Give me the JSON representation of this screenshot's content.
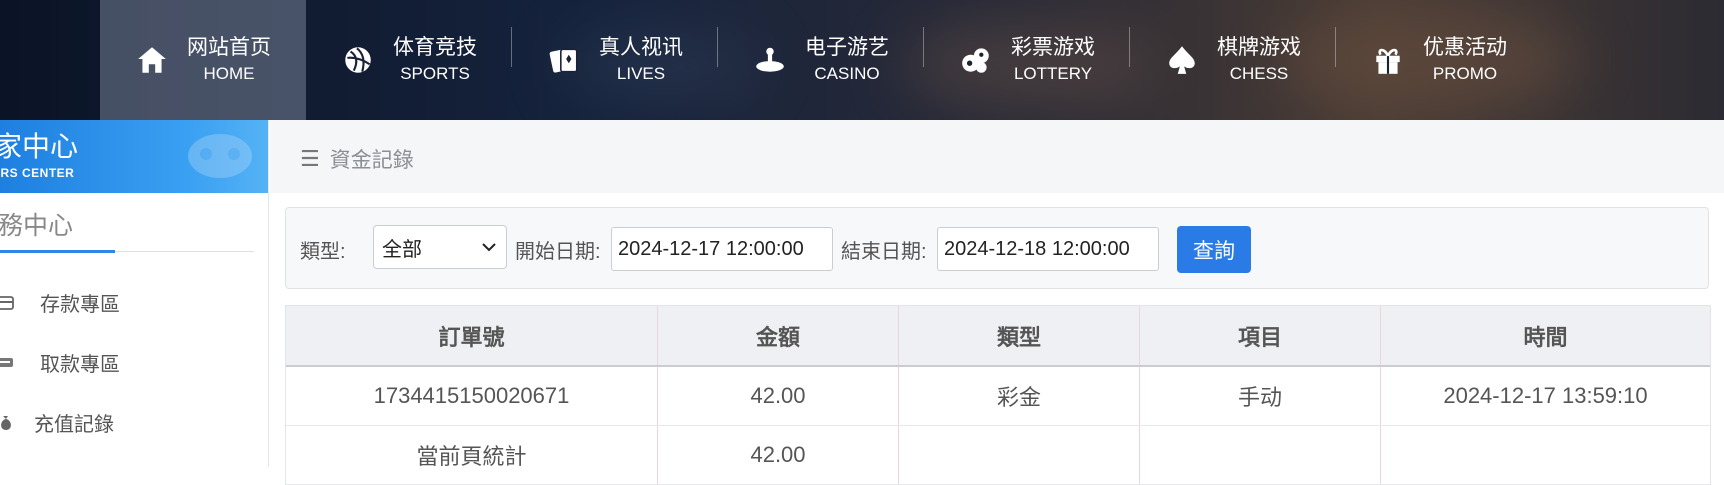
{
  "nav": {
    "items": [
      {
        "cn": "网站首页",
        "en": "HOME",
        "icon": "home-icon",
        "active": true
      },
      {
        "cn": "体育竞技",
        "en": "SPORTS",
        "icon": "ball-icon"
      },
      {
        "cn": "真人视讯",
        "en": "LIVES",
        "icon": "cards-icon"
      },
      {
        "cn": "电子游艺",
        "en": "CASINO",
        "icon": "roulette-icon"
      },
      {
        "cn": "彩票游戏",
        "en": "LOTTERY",
        "icon": "balls-icon"
      },
      {
        "cn": "棋牌游戏",
        "en": "CHESS",
        "icon": "spade-icon"
      },
      {
        "cn": "优惠活动",
        "en": "PROMO",
        "icon": "gift-icon"
      }
    ]
  },
  "sidebar": {
    "banner_title": "家中心",
    "banner_subtitle": "ERS CENTER",
    "section_title": "務中心",
    "items": [
      {
        "label": "存款專區",
        "icon": "card-icon"
      },
      {
        "label": "取款專區",
        "icon": "withdraw-icon"
      },
      {
        "label": "充值記錄",
        "icon": "moneybag-icon"
      }
    ]
  },
  "breadcrumb": {
    "title": "資金記錄",
    "icon": "menu-icon"
  },
  "filter": {
    "type_label": "類型:",
    "type_value": "全部",
    "start_label": "開始日期:",
    "start_value": "2024-12-17 12:00:00",
    "end_label": "結束日期:",
    "end_value": "2024-12-18 12:00:00",
    "query_label": "查詢"
  },
  "table": {
    "headers": [
      "訂單號",
      "金額",
      "類型",
      "項目",
      "時間"
    ],
    "rows": [
      [
        "1734415150020671",
        "42.00",
        "彩金",
        "手动",
        "2024-12-17 13:59:10"
      ],
      [
        "當前頁統計",
        "42.00",
        "",
        "",
        ""
      ]
    ]
  },
  "colors": {
    "accent": "#2a7be6",
    "banner": "#2f8fe8"
  }
}
